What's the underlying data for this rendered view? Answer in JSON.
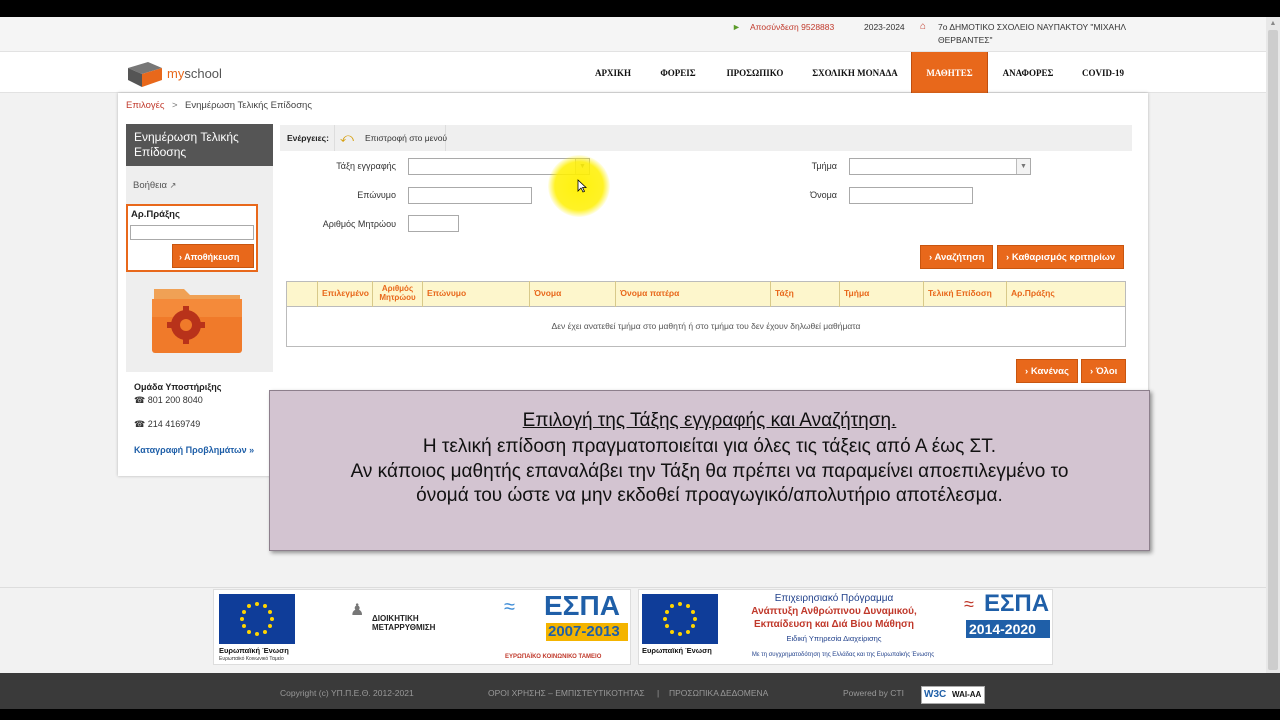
{
  "topbar": {
    "logout": "Αποσύνδεση 9528883",
    "year": "2023-2024",
    "school": "7ο ΔΗΜΟΤΙΚΟ ΣΧΟΛΕΙΟ ΝΑΥΠΑΚΤΟΥ \"ΜΙΧΑΗΛ",
    "school_line2": "ΘΕΡΒΑΝΤΕΣ\""
  },
  "logo": {
    "prefix": "my",
    "suffix": "school"
  },
  "nav": [
    {
      "label": "ΑΡΧΙΚΗ"
    },
    {
      "label": "ΦΟΡΕΙΣ"
    },
    {
      "label": "ΠΡΟΣΩΠΙΚΟ"
    },
    {
      "label": "ΣΧΟΛΙΚΗ ΜΟΝΑΔΑ"
    },
    {
      "label": "ΜΑΘΗΤΕΣ",
      "active": true
    },
    {
      "label": "ΑΝΑΦΟΡΕΣ"
    },
    {
      "label": "COVID-19"
    }
  ],
  "breadcrumb": {
    "root": "Επιλογές",
    "separator": ">",
    "current": "Ενημέρωση Τελικής Επίδοσης"
  },
  "sidebar": {
    "title": "Ενημέρωση Τελικής Επίδοσης",
    "help": "Βοήθεια",
    "act_label": "Αρ.Πράξης",
    "save_button": "Αποθήκευση",
    "support_title": "Ομάδα Υποστήριξης",
    "phone1": "801 200 8040",
    "phone2": "214 4169749",
    "report_link": "Καταγραφή Προβλημάτων »"
  },
  "actions": {
    "label": "Ενέργειες:",
    "back": "Επιστροφή στο μενού"
  },
  "form": {
    "class_label": "Τάξη εγγραφής",
    "section_label": "Τμήμα",
    "surname_label": "Επώνυμο",
    "name_label": "Όνομα",
    "registry_label": "Αριθμός Μητρώου",
    "search_button": "Αναζήτηση",
    "clear_button": "Καθαρισμός κριτηρίων"
  },
  "grid": {
    "columns": [
      "Επιλεγμένο",
      "Αριθμός Μητρώου",
      "Επώνυμο",
      "Όνομα",
      "Όνομα πατέρα",
      "Τάξη",
      "Τμήμα",
      "Τελική Επίδοση",
      "Αρ.Πράξης"
    ],
    "empty_message": "Δεν έχει ανατεθεί τμήμα στο μαθητή ή στο τμήμα του δεν έχουν δηλωθεί μαθήματα",
    "none_button": "Κανένας",
    "all_button": "Όλοι"
  },
  "overlay": {
    "title": "Επιλογή της Τάξης εγγραφής και Αναζήτηση.",
    "line1": "Η τελική επίδοση πραγματοποιείται για όλες τις τάξεις από Α έως ΣΤ.",
    "line2": "Αν κάποιος μαθητής επαναλάβει την Τάξη θα πρέπει να παραμείνει αποεπιλεγμένο το",
    "line3": "όνομά του ώστε να μην εκδοθεί προαγωγικό/απολυτήριο αποτέλεσμα."
  },
  "banners": {
    "eu": "Ευρωπαϊκή Ένωση",
    "eu_fund1": "Ευρωπαϊκό Κοινωνικό Ταμείο",
    "admin_reform": "ΔΙΟΙΚΗΤΙΚΗ ΜΕΤΑΡΡΥΘΜΙΣΗ",
    "espa1_years": "2007-2013",
    "espa_word": "ΕΣΠΑ",
    "espa1_fund": "ΕΥΡΩΠΑΪΚΟ ΚΟΙΝΩΝΙΚΟ ΤΑΜΕΙΟ",
    "op_line1": "Επιχειρησιακό Πρόγραμμα",
    "op_line2": "Ανάπτυξη Ανθρώπινου Δυναμικού,",
    "op_line3": "Εκπαίδευση και Διά Βίου Μάθηση",
    "op_line4": "Ειδική Υπηρεσία Διαχείρισης",
    "op_line5": "Με τη συγχρηματοδότηση της Ελλάδας και της Ευρωπαϊκής Ένωσης",
    "espa2_years": "2014-2020"
  },
  "footer": {
    "copyright": "Copyright (c) ΥΠ.Π.Ε.Θ. 2012-2021",
    "terms": "ΟΡΟΙ ΧΡΗΣΗΣ – ΕΜΠΙΣΤΕΥΤΙΚΟΤΗΤΑΣ",
    "sep": "|",
    "personal_data": "ΠΡΟΣΩΠΙΚΑ ΔΕΔΟΜΕΝΑ",
    "powered": "Powered by CTI",
    "wai": "WAI-AA"
  },
  "colors": {
    "accent": "#e8681b",
    "overlay_bg": "#d3c4d1",
    "grid_head": "#fdf6cc"
  }
}
